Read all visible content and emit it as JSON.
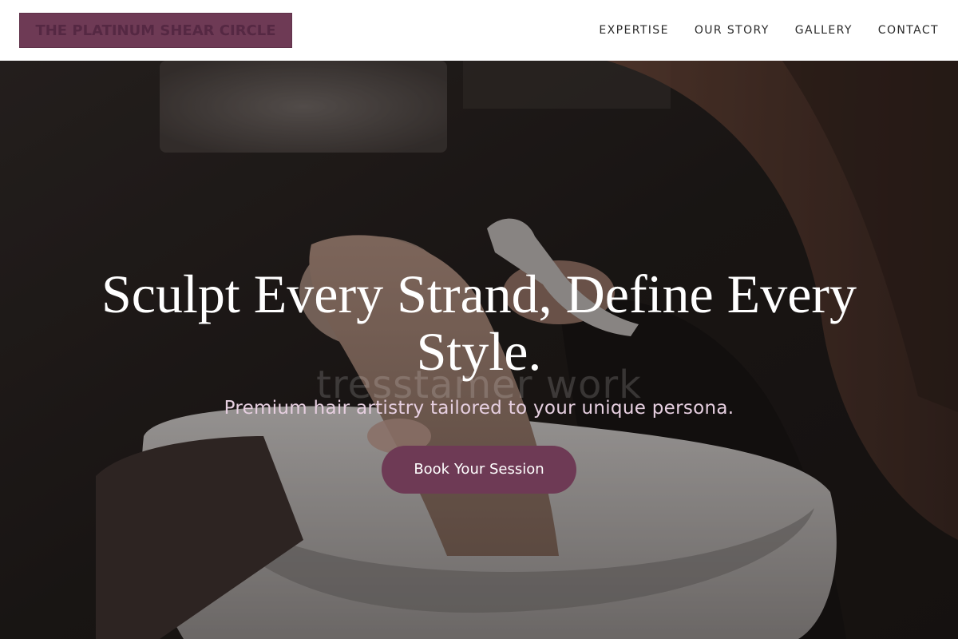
{
  "brand": {
    "name": "THE PLATINUM SHEAR CIRCLE"
  },
  "nav": {
    "items": [
      {
        "label": "EXPERTISE"
      },
      {
        "label": "OUR STORY"
      },
      {
        "label": "GALLERY"
      },
      {
        "label": "CONTACT"
      }
    ]
  },
  "hero": {
    "title": "Sculpt Every Strand, Define Every Style.",
    "watermark": "tresstamer work",
    "subtitle": "Premium hair artistry tailored to your unique persona.",
    "cta_label": "Book Your Session"
  },
  "colors": {
    "accent": "#6e3a55",
    "subtitle_text": "#e6cfe0",
    "header_bg": "#ffffff"
  },
  "icons": []
}
